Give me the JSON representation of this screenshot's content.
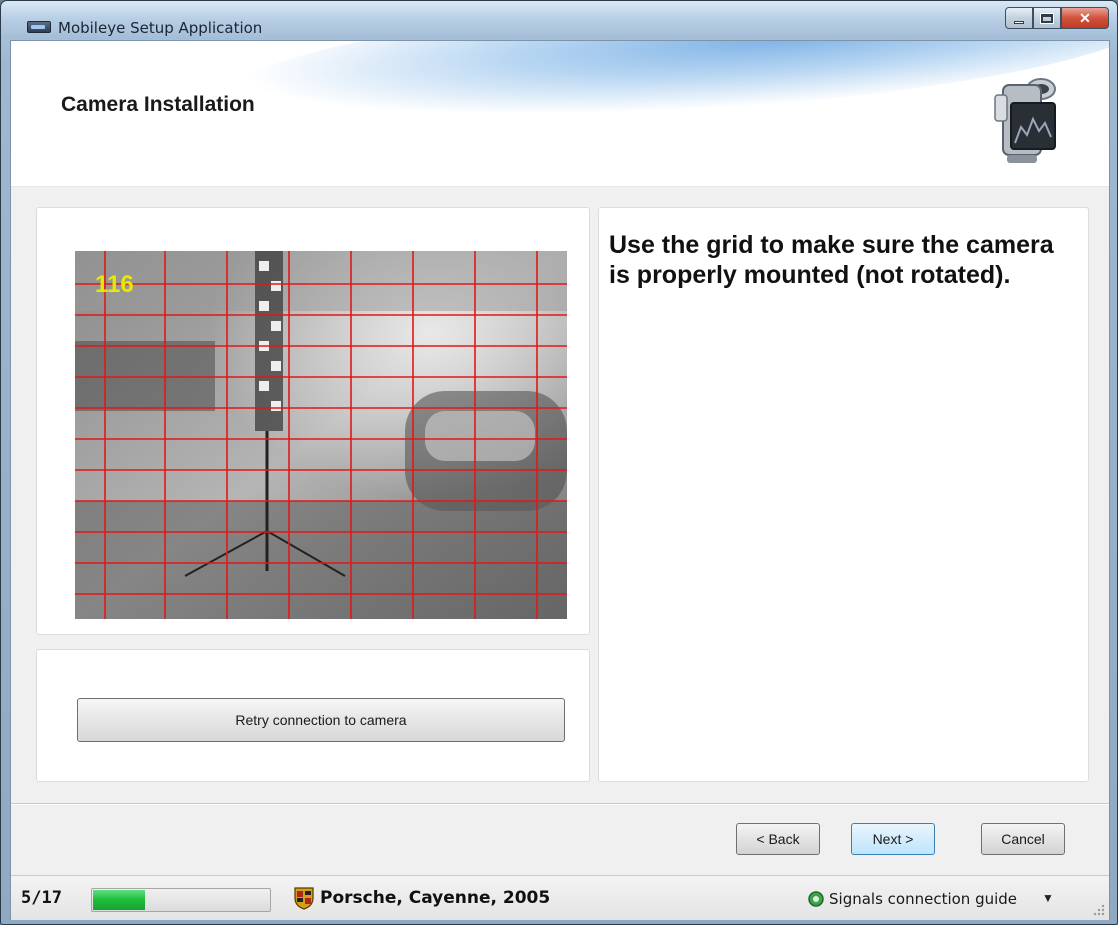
{
  "window": {
    "title": "Mobileye Setup Application"
  },
  "header": {
    "title": "Camera Installation"
  },
  "camera": {
    "frame_counter": "116"
  },
  "instructions": {
    "text": "Use the grid to make sure the camera is properly mounted (not rotated)."
  },
  "buttons": {
    "retry": "Retry connection to camera",
    "back": "< Back",
    "next": "Next >",
    "cancel": "Cancel"
  },
  "status": {
    "step": "5/17",
    "progress": {
      "current": 5,
      "total": 17
    },
    "vehicle": "Porsche, Cayenne, 2005",
    "signals_guide": "Signals connection guide"
  },
  "colors": {
    "grid_line": "#e01818",
    "progress_fill": "#1fbb3b",
    "frame_counter": "#e8e800"
  },
  "icons": {
    "app": "app-icon",
    "header": "camcorder-icon",
    "vehicle": "car-logo-icon",
    "signals": "signals-icon",
    "dropdown": "dropdown-icon"
  }
}
